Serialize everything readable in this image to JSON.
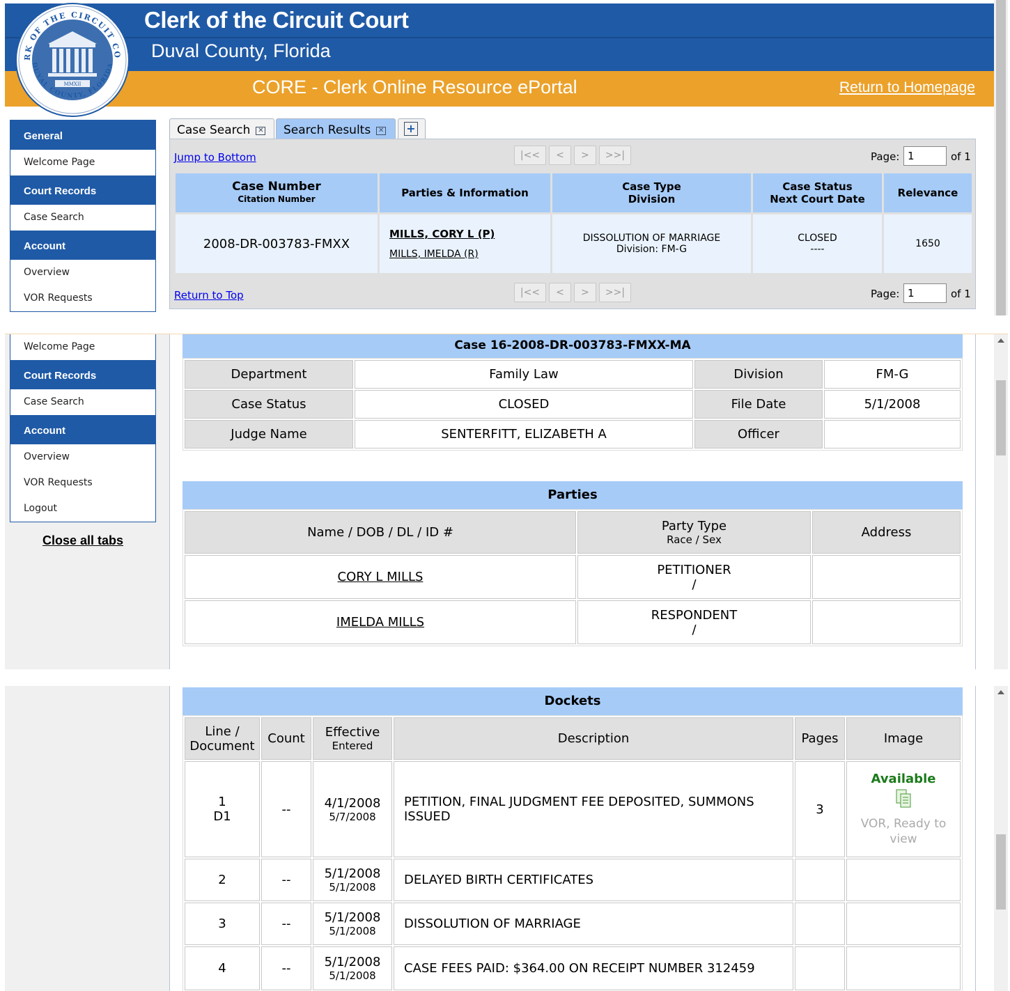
{
  "header": {
    "title": "Clerk of the Circuit Court",
    "subtitle": "Duval County, Florida",
    "portal": "CORE - Clerk Online Resource ePortal",
    "home_link": "Return to Homepage",
    "seal": {
      "top_text": "CLERK OF THE CIRCUIT COURT",
      "bottom_text": "DUVAL COUNTY, FLORIDA",
      "year": "MMXII"
    }
  },
  "sidebar": {
    "general": "General",
    "welcome": "Welcome Page",
    "court_records": "Court Records",
    "case_search": "Case Search",
    "account": "Account",
    "overview": "Overview",
    "vor_requests": "VOR Requests",
    "logout": "Logout",
    "close_tabs": "Close all tabs"
  },
  "tabs": {
    "case_search": "Case Search",
    "search_results": "Search Results",
    "add": "+"
  },
  "results": {
    "jump_bottom": "Jump to Bottom",
    "return_top": "Return to Top",
    "pager": {
      "first": "|<<",
      "prev": "<",
      "next": ">",
      "last": ">>|",
      "page_label": "Page:",
      "page_value": "1",
      "of": "of 1"
    },
    "headers": {
      "case_number": "Case Number",
      "citation": "Citation Number",
      "parties": "Parties & Information",
      "case_type": "Case Type",
      "division": "Division",
      "case_status": "Case Status",
      "next_date": "Next Court Date",
      "relevance": "Relevance"
    },
    "row": {
      "case_number": "2008-DR-003783-FMXX",
      "party1": "MILLS, CORY L (P)",
      "party2": "MILLS, IMELDA (R)",
      "case_type": "DISSOLUTION OF MARRIAGE",
      "division": "Division: FM-G",
      "status": "CLOSED",
      "next_date": "----",
      "relevance": "1650"
    }
  },
  "case": {
    "title": "Case 16-2008-DR-003783-FMXX-MA",
    "department_label": "Department",
    "department": "Family Law",
    "division_label": "Division",
    "division": "FM-G",
    "status_label": "Case Status",
    "status": "CLOSED",
    "file_date_label": "File Date",
    "file_date": "5/1/2008",
    "judge_label": "Judge Name",
    "judge": "SENTERFITT, ELIZABETH A",
    "officer_label": "Officer",
    "officer": ""
  },
  "parties": {
    "title": "Parties",
    "col_name": "Name / DOB / DL / ID #",
    "col_type": "Party Type",
    "col_type_sub": "Race / Sex",
    "col_address": "Address",
    "rows": [
      {
        "name": "CORY L MILLS",
        "type": "PETITIONER",
        "race_sex": "/",
        "address": ""
      },
      {
        "name": "IMELDA MILLS",
        "type": "RESPONDENT",
        "race_sex": "/",
        "address": ""
      }
    ]
  },
  "dockets": {
    "title": "Dockets",
    "col_line": "Line /",
    "col_line2": "Document",
    "col_count": "Count",
    "col_effective": "Effective",
    "col_entered": "Entered",
    "col_description": "Description",
    "col_pages": "Pages",
    "col_image": "Image",
    "rows": [
      {
        "line": "1",
        "doc": "D1",
        "count": "--",
        "effective": "4/1/2008",
        "entered": "5/7/2008",
        "description": "PETITION, FINAL JUDGMENT FEE DEPOSITED, SUMMONS ISSUED",
        "pages": "3",
        "image_status": "Available",
        "image_note": "VOR, Ready to view"
      },
      {
        "line": "2",
        "doc": "",
        "count": "--",
        "effective": "5/1/2008",
        "entered": "5/1/2008",
        "description": "DELAYED BIRTH CERTIFICATES",
        "pages": "",
        "image_status": "",
        "image_note": ""
      },
      {
        "line": "3",
        "doc": "",
        "count": "--",
        "effective": "5/1/2008",
        "entered": "5/1/2008",
        "description": "DISSOLUTION OF MARRIAGE",
        "pages": "",
        "image_status": "",
        "image_note": ""
      },
      {
        "line": "4",
        "doc": "",
        "count": "--",
        "effective": "5/1/2008",
        "entered": "5/1/2008",
        "description": "CASE FEES PAID: $364.00 ON RECEIPT NUMBER 312459",
        "pages": "",
        "image_status": "",
        "image_note": ""
      }
    ]
  },
  "colors": {
    "primary_blue": "#1f5aa6",
    "orange": "#eba12a",
    "header_cell": "#a6cbf7",
    "available_green": "#1b7a1b"
  }
}
